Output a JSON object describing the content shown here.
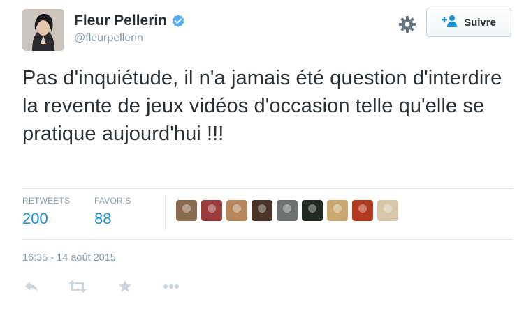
{
  "author": {
    "name": "Fleur Pellerin",
    "handle": "@fleurpellerin",
    "verified": true
  },
  "follow_button": {
    "label": "Suivre",
    "icon": "add-user-icon"
  },
  "tweet": {
    "text": "Pas d'inquiétude, il n'a jamais été question d'interdire la revente de jeux vidéos d'occasion telle qu'elle se pratique aujourd'hui !!!",
    "timestamp": "16:35 - 14 août 2015"
  },
  "stats": {
    "retweets_label": "RETWEETS",
    "retweets_value": "200",
    "favorites_label": "FAVORIS",
    "favorites_value": "88"
  },
  "favoriters": [
    {
      "icon": "user-avatar-1",
      "color": "#8a6a4f"
    },
    {
      "icon": "user-avatar-2",
      "color": "#9b3b3b"
    },
    {
      "icon": "user-avatar-3",
      "color": "#b5875a"
    },
    {
      "icon": "user-avatar-4",
      "color": "#4a3528"
    },
    {
      "icon": "user-avatar-5",
      "color": "#6e7272"
    },
    {
      "icon": "user-avatar-6",
      "color": "#1f2a22"
    },
    {
      "icon": "user-avatar-7",
      "color": "#c8a870"
    },
    {
      "icon": "user-avatar-8",
      "color": "#b23a1e"
    },
    {
      "icon": "user-avatar-9",
      "color": "#d8c6a8"
    }
  ],
  "actions": [
    "reply-icon",
    "retweet-icon",
    "favorite-icon",
    "more-icon"
  ],
  "colors": {
    "link_blue": "#1f8fce",
    "verified_blue": "#55acee",
    "muted_text": "#8899a6",
    "action_icon": "#ccd6dd"
  }
}
